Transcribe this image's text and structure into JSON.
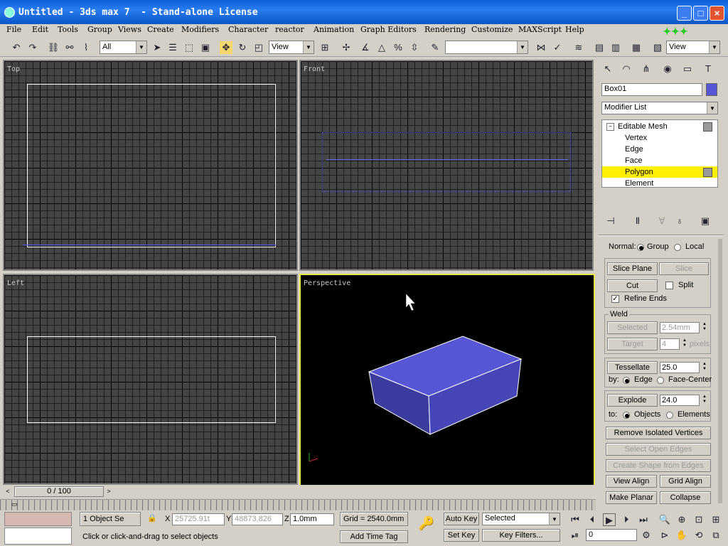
{
  "window": {
    "title": "Untitled - 3ds max 7  - Stand-alone License"
  },
  "menu": [
    "File",
    "Edit",
    "Tools",
    "Group",
    "Views",
    "Create",
    "Modifiers",
    "Character",
    "reactor",
    "Animation",
    "Graph Editors",
    "Rendering",
    "Customize",
    "MAXScript",
    "Help"
  ],
  "toolbar": {
    "selection_filter": "All",
    "ref_coord": "View",
    "named_set": "",
    "view_combo": "View"
  },
  "viewports": {
    "top": "Top",
    "front": "Front",
    "left": "Left",
    "perspective": "Perspective"
  },
  "command_panel": {
    "object_name": "Box01",
    "modifier_list": "Modifier List",
    "stack": [
      "Editable Mesh",
      "Vertex",
      "Edge",
      "Face",
      "Polygon",
      "Element"
    ],
    "normal_label": "Normal:",
    "normal_group": "Group",
    "normal_local": "Local",
    "slice_plane": "Slice Plane",
    "slice": "Slice",
    "cut": "Cut",
    "split": "Split",
    "refine_ends": "Refine Ends",
    "weld": "Weld",
    "selected": "Selected",
    "selected_value": "2.54mm",
    "target": "Target",
    "target_value": "4",
    "pixels": "pixels",
    "tessellate": "Tessellate",
    "tessellate_value": "25.0",
    "by": "by:",
    "edge": "Edge",
    "face_center": "Face-Center",
    "explode": "Explode",
    "explode_value": "24.0",
    "to": "to:",
    "objects": "Objects",
    "elements": "Elements",
    "remove_isolated": "Remove Isolated Vertices",
    "select_open_edges": "Select Open Edges",
    "create_shape": "Create Shape from Edges",
    "view_align": "View Align",
    "grid_align": "Grid Align",
    "make_planar": "Make Planar",
    "collapse": "Collapse"
  },
  "status": {
    "timeline": "0 / 100",
    "object_sel": "1 Object Se",
    "x_val": "25725.91t",
    "y_val": "48873.826",
    "z_val": "1.0mm",
    "grid": "Grid = 2540.0mm",
    "auto_key": "Auto Key",
    "set_key": "Set Key",
    "selected": "Selected",
    "key_filters": "Key Filters...",
    "frame": "0",
    "prompt": "Click or click-and-drag to select objects",
    "add_time_tag": "Add Time Tag"
  }
}
